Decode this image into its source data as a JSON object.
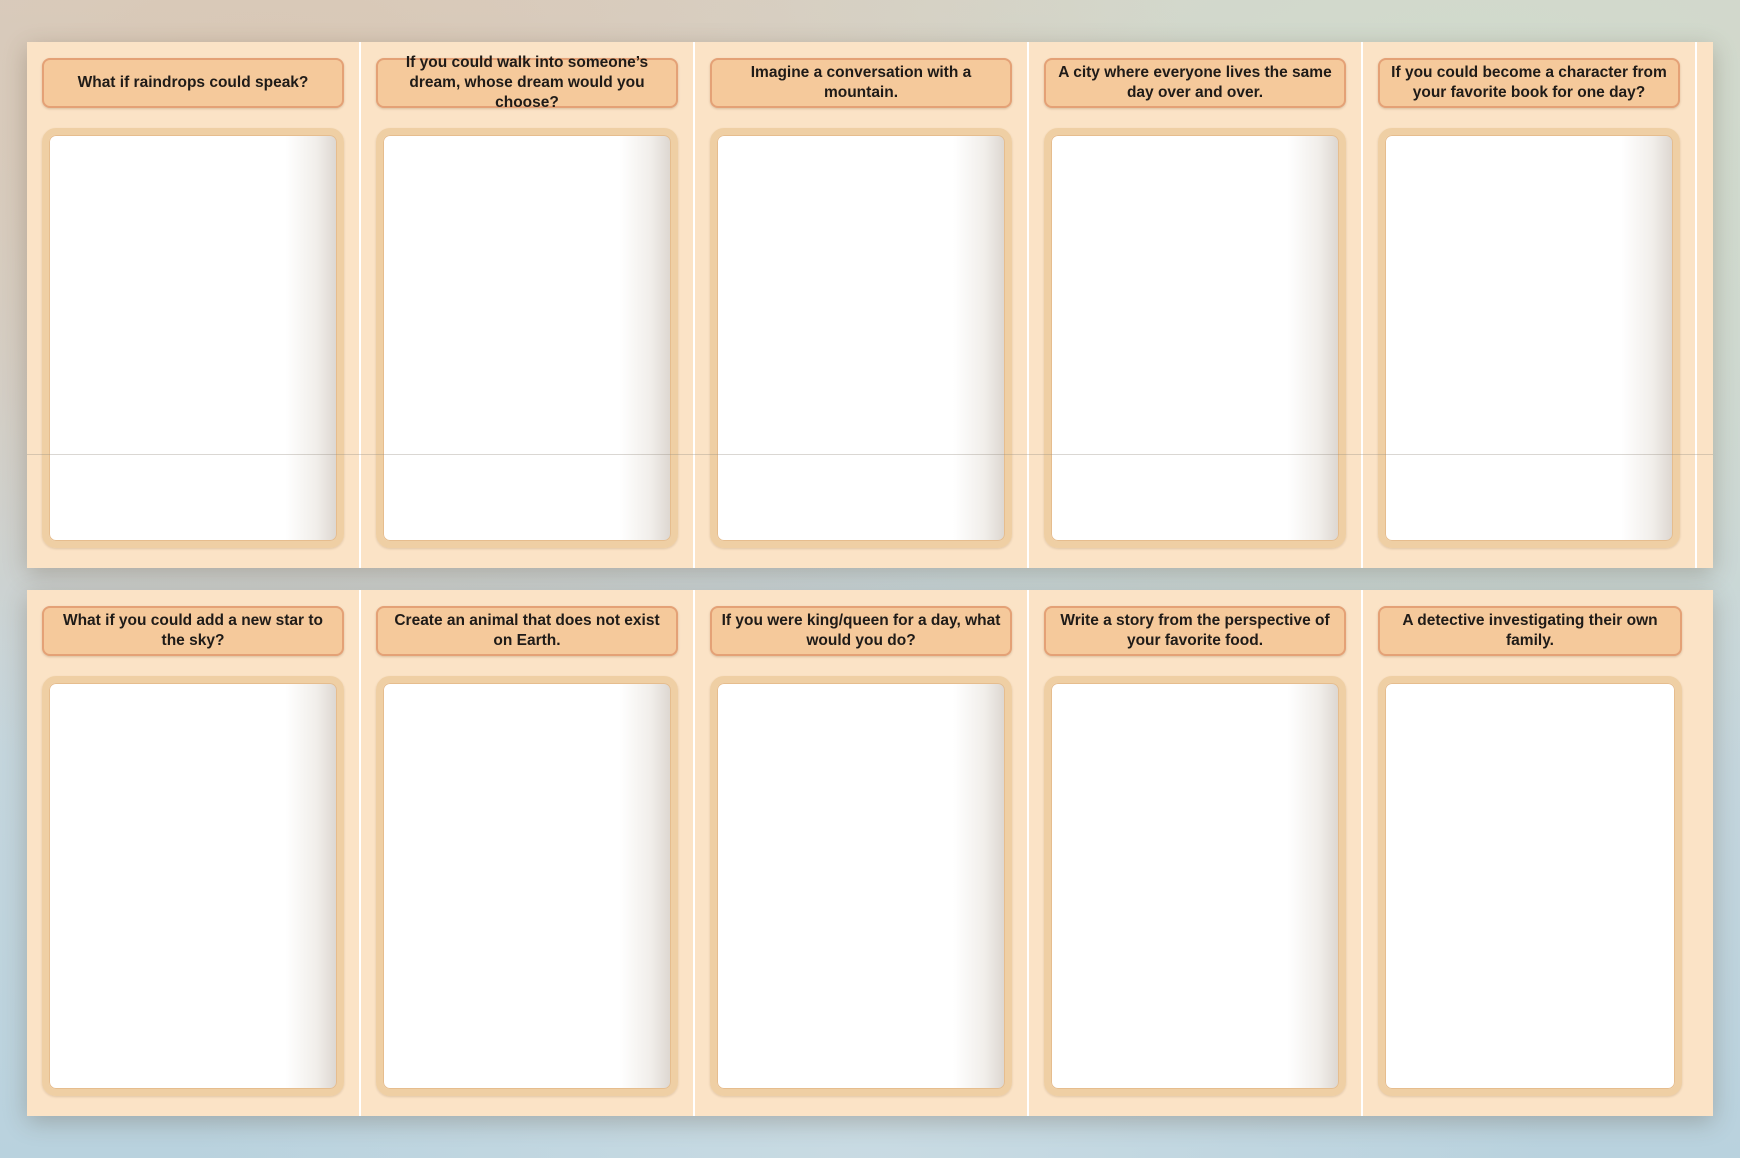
{
  "rows": [
    {
      "cards": [
        {
          "prompt": "What if raindrops could speak?"
        },
        {
          "prompt": "If you could walk into someone’s dream, whose dream would you choose?"
        },
        {
          "prompt": "Imagine a conversation with a mountain."
        },
        {
          "prompt": "A city where everyone lives the same day over and over."
        },
        {
          "prompt": "If you could become a character from your favorite book for one day?"
        }
      ]
    },
    {
      "cards": [
        {
          "prompt": "What if you could add a new star to the sky?"
        },
        {
          "prompt": "Create an animal that does not exist on Earth."
        },
        {
          "prompt": "If you were king/queen for a day, what would you do?"
        },
        {
          "prompt": "Write a story from the perspective of your favorite food."
        },
        {
          "prompt": "A detective investigating their own family."
        }
      ]
    }
  ],
  "colors": {
    "card_background": "#fbe3c6",
    "prompt_fill": "#f5c99b",
    "prompt_border": "#e4a176",
    "panel_border": "#efcfa4",
    "text": "#1f1b18"
  }
}
